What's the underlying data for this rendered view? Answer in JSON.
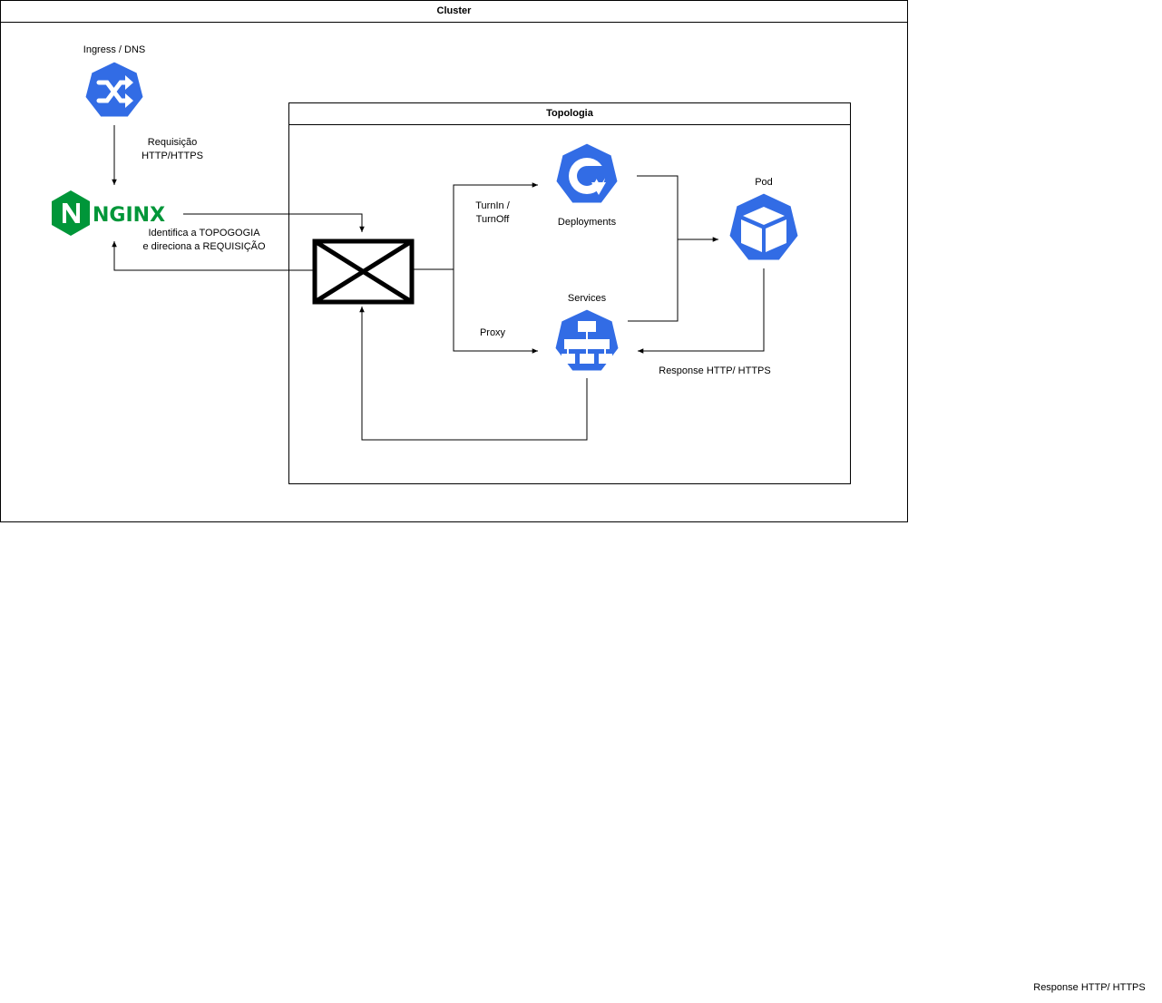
{
  "cluster": {
    "title": "Cluster"
  },
  "topology": {
    "title": "Topologia"
  },
  "nodes": {
    "ingress": {
      "label": "Ingress / DNS",
      "icon": "ingress-shuffle-icon"
    },
    "nginx": {
      "logo_text": "NGINX",
      "icon": "nginx-logo-icon",
      "color": "#009639"
    },
    "gateway": {
      "icon": "gateway-x-box-icon"
    },
    "deployments": {
      "label": "Deployments",
      "icon": "deployment-refresh-icon"
    },
    "services": {
      "label": "Services",
      "icon": "service-tree-icon"
    },
    "pod": {
      "label": "Pod",
      "icon": "pod-cube-icon"
    }
  },
  "edges": {
    "request_line1": "Requisição",
    "request_line2": "HTTP/HTTPS",
    "identify_line1": "Identifica a TOPOGOGIA",
    "identify_line2": "e direciona a REQUISIÇÃO",
    "turn_line1": "TurnIn /",
    "turn_line2": "TurnOff",
    "proxy": "Proxy",
    "response": "Response HTTP/ HTTPS"
  },
  "orphan_label": "Response HTTP/ HTTPS",
  "colors": {
    "k8s_blue": "#326CE5",
    "nginx_green": "#009639",
    "line": "#000000"
  }
}
